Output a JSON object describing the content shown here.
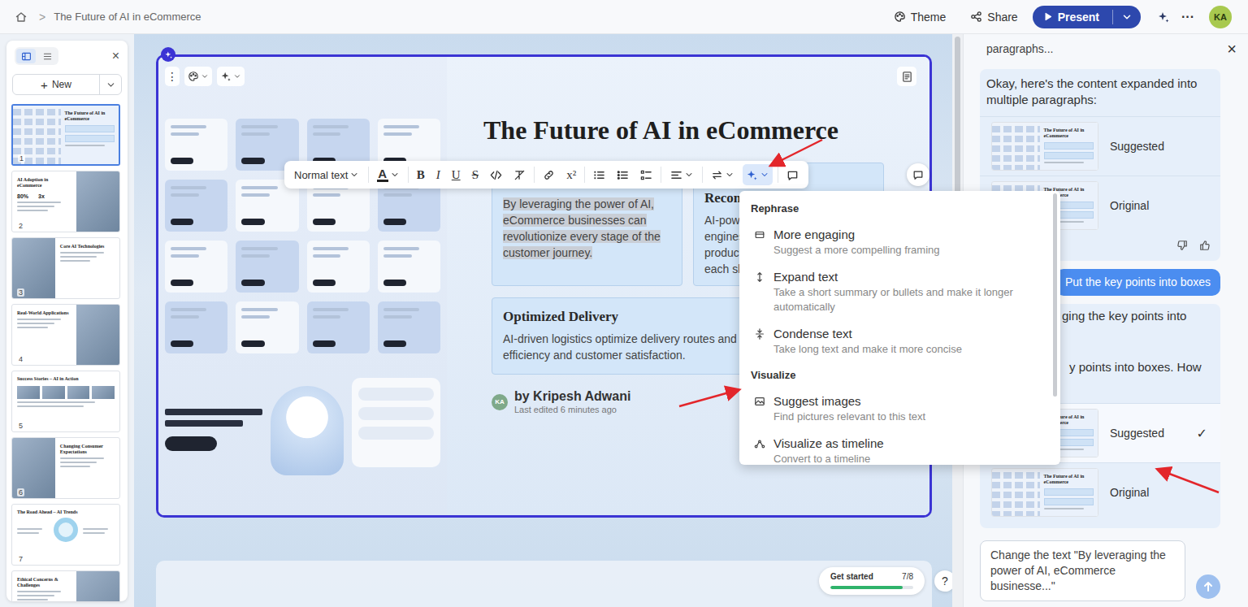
{
  "topbar": {
    "crumb_separator": ">",
    "title": "The Future of AI in eCommerce",
    "theme": "Theme",
    "share": "Share",
    "present": "Present",
    "more": "···",
    "avatar": "KA"
  },
  "sidebar": {
    "views": [
      {
        "selected": true
      },
      {
        "selected": false
      }
    ],
    "close": "×",
    "new_icon": "+",
    "new_label": "New",
    "slides": [
      {
        "number": "1",
        "title": "The Future of AI in eCommerce",
        "kind": "cover",
        "selected": true
      },
      {
        "number": "2",
        "title": "AI Adoption in eCommerce",
        "stats": [
          "80%",
          "3x"
        ],
        "kind": "image-right",
        "selected": false
      },
      {
        "number": "3",
        "title": "Core AI Technologies",
        "kind": "image-left",
        "selected": false
      },
      {
        "number": "4",
        "title": "Real-World Applications",
        "kind": "image-right",
        "selected": false
      },
      {
        "number": "5",
        "title": "Success Stories – AI in Action",
        "kind": "gallery",
        "selected": false
      },
      {
        "number": "6",
        "title": "Changing Consumer Expectations",
        "kind": "image-left",
        "selected": false
      },
      {
        "number": "7",
        "title": "The Road Ahead – AI Trends",
        "kind": "circle",
        "selected": false
      },
      {
        "title": "Ethical Concerns & Challenges",
        "kind": "image-right",
        "selected": false
      }
    ]
  },
  "slide": {
    "title": "The Future of AI in eCommerce",
    "more": "⋮",
    "cards": [
      {
        "kind": "text",
        "body": "By leveraging the power of AI, eCommerce businesses can revolutionize every stage of the customer journey.",
        "selected": true
      },
      {
        "kind": "heading",
        "heading": "Recom",
        "lines": [
          "AI-powe",
          "engines",
          "product",
          "each sh"
        ],
        "selected": false
      },
      {
        "kind": "heading",
        "heading": "Optimized Delivery",
        "lines": [
          "AI-driven logistics optimize delivery routes and tim",
          "efficiency and customer satisfaction."
        ],
        "selected": false
      }
    ],
    "author": {
      "avatar": "KA",
      "name": "by Kripesh Adwani",
      "edited": "Last edited 6 minutes ago"
    }
  },
  "toolbar": {
    "style": "Normal text",
    "color_glyph": "A",
    "marks": [
      "B",
      "I",
      "U",
      "S"
    ],
    "superscript": "x²",
    "ai_active": true
  },
  "menu": {
    "sections": [
      {
        "title": "Rephrase",
        "items": [
          {
            "label": "More engaging",
            "desc": "Suggest a more compelling framing"
          },
          {
            "label": "Expand text",
            "desc": "Take a short summary or bullets and make it longer automatically"
          },
          {
            "label": "Condense text",
            "desc": "Take long text and make it more concise"
          }
        ]
      },
      {
        "title": "Visualize",
        "items": [
          {
            "label": "Suggest images",
            "desc": "Find pictures relevant to this text"
          },
          {
            "label": "Visualize as timeline",
            "desc": "Convert to a timeline"
          }
        ]
      }
    ]
  },
  "progress": {
    "label": "Get started",
    "count": "7/8",
    "level": 0.875
  },
  "help": "?",
  "chat": {
    "header": "paragraphs...",
    "close": "×",
    "check": "✓",
    "messages": [
      {
        "role": "assistant",
        "text": "Okay, here's the content expanded into multiple paragraphs:",
        "feedback": true,
        "versions": [
          {
            "label": "Suggested",
            "thumb_title": "The Future of AI in eCommerce",
            "selected": false
          },
          {
            "label": "Original",
            "thumb_title": "The Future of AI in eCommerce",
            "selected": false
          }
        ]
      },
      {
        "role": "user",
        "text": "Put the key points into boxes"
      },
      {
        "role": "assistant",
        "lines": [
          "ging the key points into",
          "y points into boxes. How"
        ],
        "feedback": false,
        "versions": [
          {
            "label": "Suggested",
            "thumb_title": "The Future of AI in eCommerce",
            "selected": true
          },
          {
            "label": "Original",
            "thumb_title": "The Future of AI in eCommerce",
            "selected": false
          }
        ]
      }
    ],
    "input": {
      "value": "Change the text \"By leveraging the power of AI, eCommerce businesse...\""
    }
  }
}
